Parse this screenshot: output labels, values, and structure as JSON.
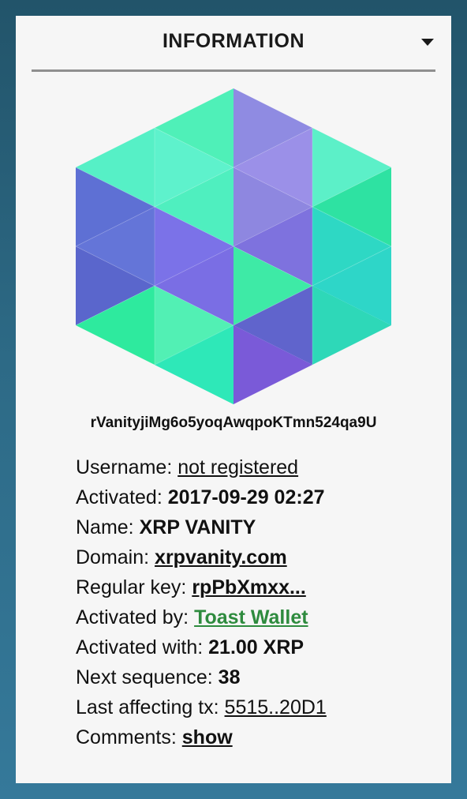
{
  "header": {
    "title": "INFORMATION",
    "toggle_icon": "caret-down-icon"
  },
  "account": {
    "address": "rVanityjiMg6o5yoqAwqpoKTmn524qa9U",
    "avatar_icon": "hexagon-identicon"
  },
  "details": {
    "username_label": "Username:",
    "username_value": "not registered",
    "activated_label": "Activated:",
    "activated_value": "2017-09-29 02:27",
    "name_label": "Name:",
    "name_value": "XRP VANITY",
    "domain_label": "Domain:",
    "domain_value": "xrpvanity.com",
    "regular_key_label": "Regular key:",
    "regular_key_value": "rpPbXmxx...",
    "activated_by_label": "Activated by:",
    "activated_by_value": "Toast Wallet",
    "activated_with_label": "Activated with:",
    "activated_with_value": "21.00 XRP",
    "next_sequence_label": "Next sequence:",
    "next_sequence_value": "38",
    "last_tx_label": "Last affecting tx:",
    "last_tx_value": "5515..20D1",
    "comments_label": "Comments:",
    "comments_value": "show"
  },
  "colors": {
    "background_top": "#22546a",
    "background_bottom": "#35799a",
    "panel": "#f6f6f6",
    "link_green": "#2e8b3e",
    "identicon_palette": [
      "#5cf0c8",
      "#4ef0b4",
      "#2ee8a8",
      "#6a7fe0",
      "#7c75e8",
      "#8e86e0",
      "#9a8ee6",
      "#5a62c8",
      "#7a5ad8",
      "#2ed8c0"
    ]
  }
}
